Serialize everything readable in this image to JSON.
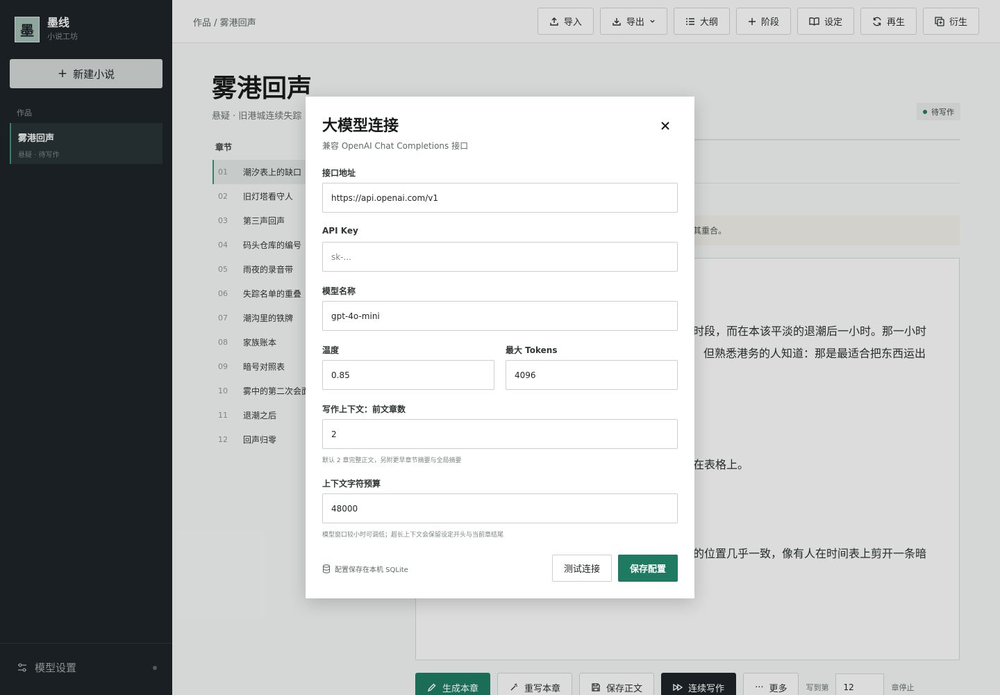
{
  "sidebar": {
    "brand_mark": "墨",
    "brand_name": "墨线",
    "brand_sub": "小说工坊",
    "new_novel_label": "新建小说",
    "section_label": "作品",
    "work_title": "雾港回声",
    "work_meta": "悬疑 · 待写作",
    "model_settings_label": "模型设置"
  },
  "topbar": {
    "breadcrumb": "作品 / 雾港回声",
    "buttons": [
      "导入",
      "导出",
      "大纲",
      "阶段",
      "设定",
      "再生",
      "衍生"
    ]
  },
  "document": {
    "title": "雾港回声",
    "meta": "悬疑 · 旧港城连续失踪",
    "status": "待写作",
    "chapters_heading": "章节",
    "chapters": [
      {
        "num": "01",
        "title": "潮汐表上的缺口"
      },
      {
        "num": "02",
        "title": "旧灯塔看守人"
      },
      {
        "num": "03",
        "title": "第三声回声"
      },
      {
        "num": "04",
        "title": "码头仓库的编号"
      },
      {
        "num": "05",
        "title": "雨夜的录音带"
      },
      {
        "num": "06",
        "title": "失踪名单的重叠"
      },
      {
        "num": "07",
        "title": "潮沟里的铁牌"
      },
      {
        "num": "08",
        "title": "家族账本"
      },
      {
        "num": "09",
        "title": "暗号对照表"
      },
      {
        "num": "10",
        "title": "雾中的第二次会面"
      },
      {
        "num": "11",
        "title": "退潮之后"
      },
      {
        "num": "12",
        "title": "回声归零"
      }
    ],
    "note_fragment": "其重合。",
    "editor_lines": [
      "时段，而在本该平淡的退潮后一小时。那一小时",
      "但熟悉港务的人知道：那是最适合把东西运出",
      "在表格上。",
      "的位置几乎一致，像有人在时间表上剪开一条暗"
    ]
  },
  "bottom_bar": {
    "generate": "生成本章",
    "rewrite": "重写本章",
    "save_text": "保存正文",
    "continue": "连续写作",
    "more": "更多",
    "write_to_label": "写到第",
    "write_to_value": "12",
    "stop_label": "章停止"
  },
  "modal": {
    "title": "大模型连接",
    "subtitle": "兼容 OpenAI Chat Completions 接口",
    "endpoint_label": "接口地址",
    "endpoint_value": "https://api.openai.com/v1",
    "apikey_label": "API Key",
    "apikey_placeholder": "sk-...",
    "model_label": "模型名称",
    "model_value": "gpt-4o-mini",
    "temperature_label": "温度",
    "temperature_value": "0.85",
    "max_tokens_label": "最大 Tokens",
    "max_tokens_value": "4096",
    "context_chapters_label": "写作上下文：前文章数",
    "context_chapters_value": "2",
    "context_chapters_hint": "默认 2 章完整正文，另附更早章节摘要与全局摘要",
    "char_budget_label": "上下文字符预算",
    "char_budget_value": "48000",
    "char_budget_hint": "模型窗口较小时可调低；超长上下文会保留设定开头与当前章结尾",
    "footnote": "配置保存在本机 SQLite",
    "test_button": "测试连接",
    "save_button": "保存配置"
  },
  "colors": {
    "accent": "#1f7a62",
    "sidebar_bg": "#1c2326"
  }
}
